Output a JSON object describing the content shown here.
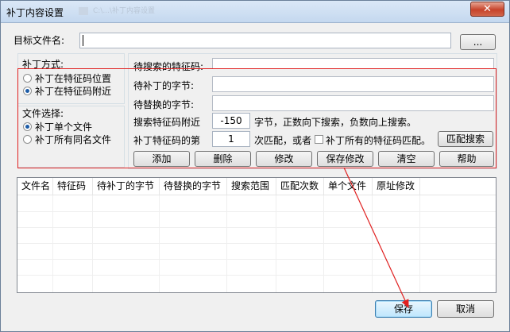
{
  "window": {
    "title": "补丁内容设置",
    "close_label": "✕",
    "background_tab_text": "C:\\...\\补丁内容设置"
  },
  "target": {
    "label": "目标文件名:",
    "value": "",
    "browse_label": "..."
  },
  "patch_mode": {
    "label": "补丁方式:",
    "options": [
      {
        "label": "补丁在特征码位置",
        "selected": false
      },
      {
        "label": "补丁在特征码附近",
        "selected": true
      }
    ]
  },
  "file_select": {
    "label": "文件选择:",
    "options": [
      {
        "label": "补丁单个文件",
        "selected": true
      },
      {
        "label": "补丁所有同名文件",
        "selected": false
      }
    ]
  },
  "form": {
    "search_code_label": "待搜索的特征码:",
    "patch_bytes_label": "待补丁的字节:",
    "replace_bytes_label": "待替换的字节:",
    "search_near_label": "搜索特征码附近",
    "search_near_value": "-150",
    "search_near_hint": "字节，正数向下搜索，负数向上搜索。",
    "match_index_label": "补丁特征码的第",
    "match_index_value": "1",
    "match_suffix": "次匹配，或者",
    "patch_all_label": "补丁所有的特征码匹配。",
    "patch_all_checked": false,
    "match_search_button": "匹配搜索"
  },
  "actions": {
    "add": "添加",
    "delete": "删除",
    "modify": "修改",
    "save_modify": "保存修改",
    "clear": "清空",
    "help": "帮助"
  },
  "table": {
    "columns": [
      "文件名",
      "特征码",
      "待补丁的字节",
      "待替换的字节",
      "搜索范围",
      "匹配次数",
      "单个文件",
      "原址修改"
    ],
    "rows": []
  },
  "footer": {
    "save": "保存",
    "cancel": "取消"
  },
  "colors": {
    "highlight_red": "#e02020",
    "selected_radio": "#1d5ca7",
    "focus_button": "#bee6fd"
  }
}
